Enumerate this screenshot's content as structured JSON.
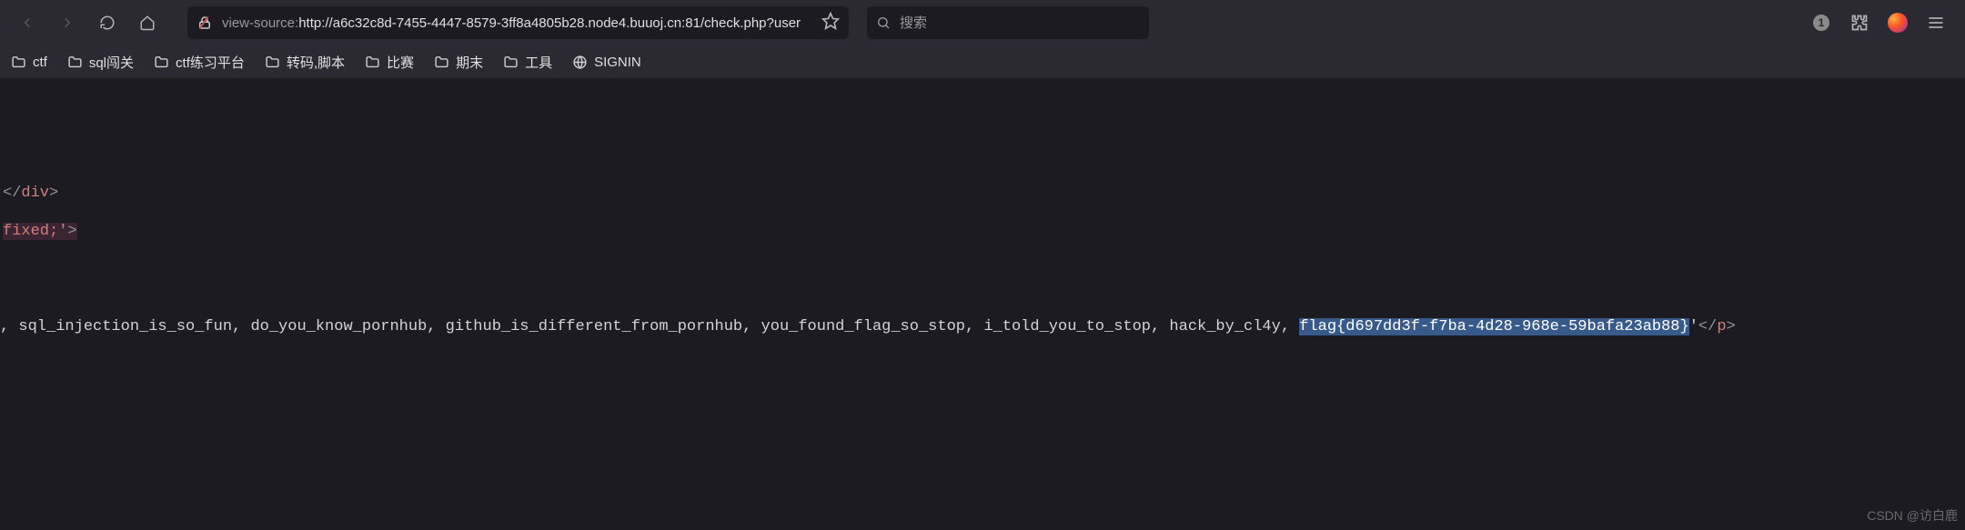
{
  "toolbar": {
    "url_prefix": "view-source:",
    "url_main": "http://a6c32c8d-7455-4447-8579-3ff8a4805b28.node4.buuoj.cn:81/check.php?user",
    "search_placeholder": "搜索",
    "badge": "1"
  },
  "bookmarks": [
    {
      "label": "ctf",
      "icon": "folder"
    },
    {
      "label": "sql闯关",
      "icon": "folder"
    },
    {
      "label": "ctf练习平台",
      "icon": "folder"
    },
    {
      "label": "转码,脚本",
      "icon": "folder"
    },
    {
      "label": "比赛",
      "icon": "folder"
    },
    {
      "label": "期末",
      "icon": "folder"
    },
    {
      "label": "工具",
      "icon": "folder"
    },
    {
      "label": "SIGNIN",
      "icon": "globe"
    }
  ],
  "source": {
    "line1": {
      "lt": "</",
      "tag": "div",
      "gt": ">"
    },
    "line2": {
      "attr": "fixed;'",
      "gt": ">"
    },
    "line3": {
      "text": ", sql_injection_is_so_fun, do_you_know_pornhub, github_is_different_from_pornhub, you_found_flag_so_stop, i_told_you_to_stop, hack_by_cl4y, ",
      "flag": "flag{d697dd3f-f7ba-4d28-968e-59bafa23ab88}",
      "quote": "'",
      "lt": "</",
      "tag": "p",
      "gt": ">"
    }
  },
  "watermark": "CSDN @访白鹿"
}
